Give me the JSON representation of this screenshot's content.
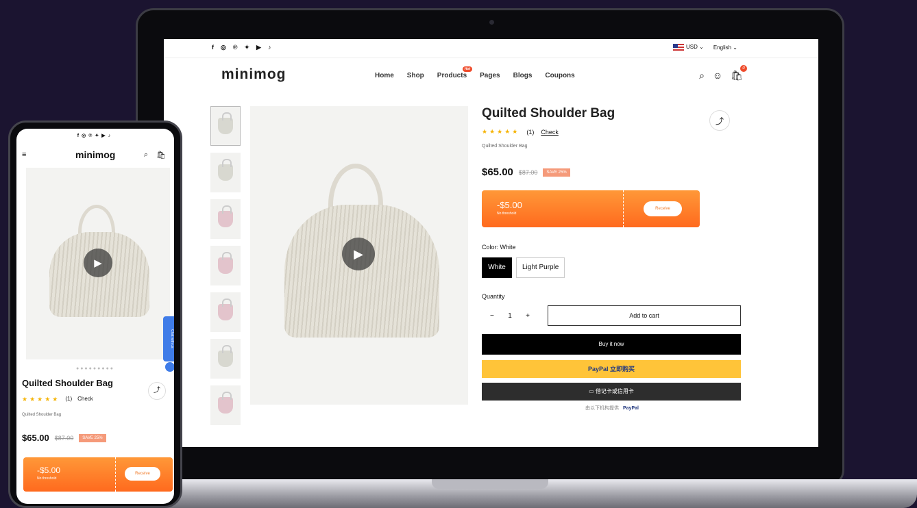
{
  "store": {
    "logo": "minimog"
  },
  "topbar": {
    "socials": [
      "f",
      "◎",
      "℗",
      "✦",
      "▶",
      "♪"
    ],
    "currency": "USD ⌄",
    "language": "English ⌄"
  },
  "nav": {
    "items": [
      "Home",
      "Shop",
      "Products",
      "Pages",
      "Blogs",
      "Coupons"
    ],
    "products_badge": "Hot",
    "cart_count": "0"
  },
  "icons": {
    "search": "⌕",
    "account": "☺",
    "cart": "🛍",
    "share": "⤴",
    "play": "▶",
    "menu": "≡"
  },
  "product": {
    "title": "Quilted Shoulder Bag",
    "stars": "★★★★★",
    "review_count": "(1)",
    "review_link": "Check",
    "subtitle": "Quilted Shoulder Bag",
    "price": "$65.00",
    "old_price": "$87.00",
    "save_badge": "SAVE 25%",
    "color_label": "Color: White",
    "colors": [
      "White",
      "Light Purple"
    ],
    "quantity_label": "Quantity",
    "quantity": "1",
    "minus": "−",
    "plus": "+",
    "add_to_cart": "Add to cart",
    "buy_now": "Buy it now",
    "paypal_label": "PayPal 立即购买",
    "card_label": "▭ 借记卡或信用卡",
    "paypal_note": "由以下机构提供",
    "paypal_brand": "PayPal"
  },
  "coupon": {
    "amount": "-$5.00",
    "note": "No threshold",
    "receive": "Receive"
  },
  "phone": {
    "dots": "●●●●●●●●●",
    "chat_label": "Chat with us"
  },
  "colors": {
    "accent_orange": "#ff7a2a",
    "badge_red": "#ef4b2b",
    "paypal_yellow": "#ffc439",
    "star_gold": "#f5b301"
  }
}
